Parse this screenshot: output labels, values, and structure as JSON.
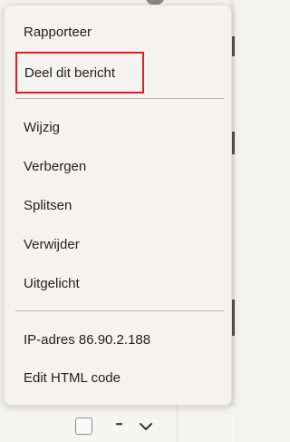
{
  "menu": {
    "items": [
      {
        "label": "Rapporteer"
      },
      {
        "label": "Deel dit bericht"
      },
      {
        "label": "Wijzig"
      },
      {
        "label": "Verbergen"
      },
      {
        "label": "Splitsen"
      },
      {
        "label": "Verwijder"
      },
      {
        "label": "Uitgelicht"
      },
      {
        "label": "IP-adres 86.90.2.188"
      },
      {
        "label": "Edit HTML code"
      }
    ]
  },
  "toolbar": {
    "more_label": "•••"
  },
  "colors": {
    "highlight": "#d4242b",
    "menu_bg": "#f4f3f1"
  }
}
